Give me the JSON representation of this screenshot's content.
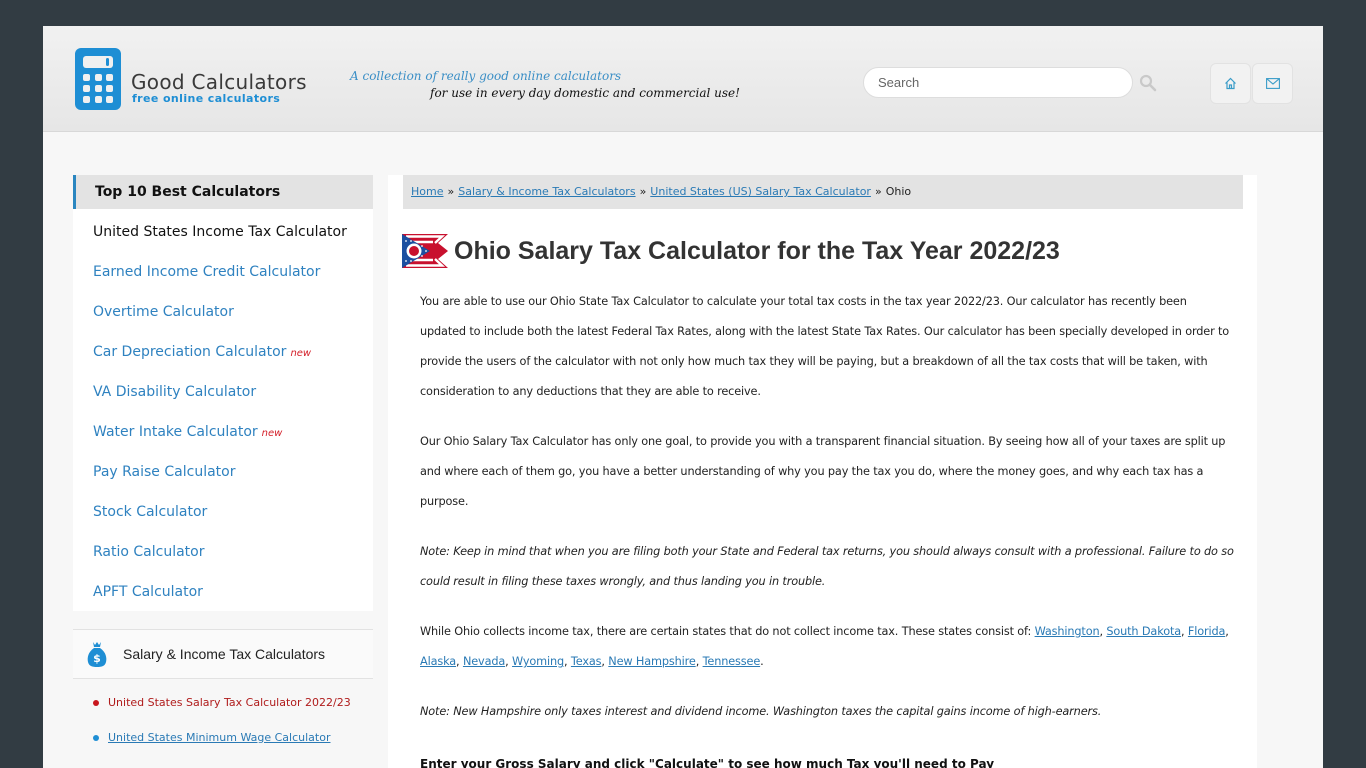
{
  "header": {
    "logo_title": "Good Calculators",
    "logo_subtitle": "free online calculators",
    "tagline_line1": "A collection of really good online calculators",
    "tagline_line2": "for use in every day domestic and commercial use!",
    "search_placeholder": "Search",
    "icons": {
      "search": "search-icon",
      "home": "home-icon",
      "mail": "mail-icon"
    }
  },
  "sidebar": {
    "top10_title": "Top 10 Best Calculators",
    "top10_items": [
      {
        "label": "United States Income Tax Calculator",
        "active": true,
        "new": ""
      },
      {
        "label": "Earned Income Credit Calculator",
        "new": ""
      },
      {
        "label": "Overtime Calculator",
        "new": ""
      },
      {
        "label": "Car Depreciation Calculator",
        "new": "new"
      },
      {
        "label": "VA Disability Calculator",
        "new": ""
      },
      {
        "label": "Water Intake Calculator",
        "new": "new"
      },
      {
        "label": "Pay Raise Calculator",
        "new": ""
      },
      {
        "label": "Stock Calculator",
        "new": ""
      },
      {
        "label": "Ratio Calculator",
        "new": ""
      },
      {
        "label": "APFT Calculator",
        "new": ""
      }
    ],
    "category_title": "Salary & Income Tax Calculators",
    "category_icon": "money-bag-icon",
    "category_links": [
      {
        "label": "United States Salary Tax Calculator 2022/23",
        "current": true,
        "bullet_color": "#c8161d"
      },
      {
        "label": "United States Minimum Wage Calculator",
        "current": false,
        "bullet_color": "#1e8ed4"
      }
    ]
  },
  "breadcrumb": {
    "items": [
      "Home",
      "Salary & Income Tax Calculators",
      "United States (US) Salary Tax Calculator"
    ],
    "current": "Ohio",
    "separator": "»"
  },
  "main": {
    "title": "Ohio Salary Tax Calculator for the Tax Year 2022/23",
    "flag_icon": "ohio-flag-icon",
    "para1": "You are able to use our Ohio State Tax Calculator to calculate your total tax costs in the tax year 2022/23. Our calculator has recently been updated to include both the latest Federal Tax Rates, along with the latest State Tax Rates. Our calculator has been specially developed in order to provide the users of the calculator with not only how much tax they will be paying, but a breakdown of all the tax costs that will be taken, with consideration to any deductions that they are able to receive.",
    "para2": "Our Ohio Salary Tax Calculator has only one goal, to provide you with a transparent financial situation. By seeing how all of your taxes are split up and where each of them go, you have a better understanding of why you pay the tax you do, where the money goes, and why each tax has a purpose.",
    "note1": "Note: Keep in mind that when you are filing both your State and Federal tax returns, you should always consult with a professional. Failure to do so could result in filing these taxes wrongly, and thus landing you in trouble.",
    "para3_prefix": "While Ohio collects income tax, there are certain states that do not collect income tax. These states consist of: ",
    "no_tax_states": [
      "Washington",
      "South Dakota",
      "Florida",
      "Alaska",
      "Nevada",
      "Wyoming",
      "Texas",
      "New Hampshire",
      "Tennessee"
    ],
    "note2": "Note: New Hampshire only taxes interest and dividend income. Washington taxes the capital gains income of high-earners.",
    "prompt": "Enter your Gross Salary and click \"Calculate\" to see how much Tax you'll need to Pay"
  }
}
